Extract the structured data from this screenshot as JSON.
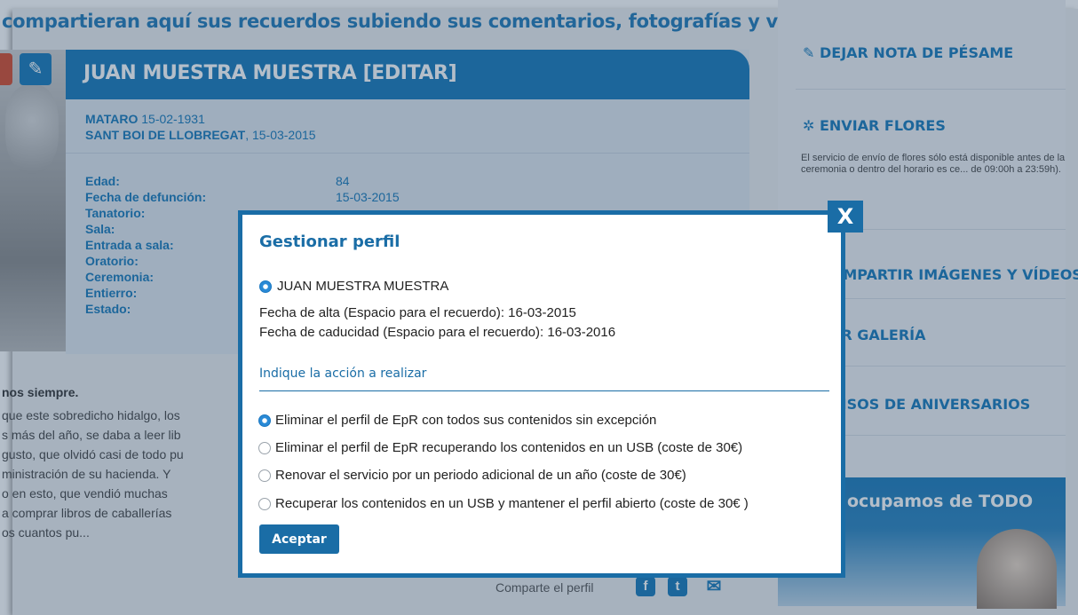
{
  "intro": "compartieran aquí sus recuerdos subiendo sus comentarios, fotografías y vídeos.",
  "profile": {
    "title": "JUAN MUESTRA MUESTRA [EDITAR]",
    "birth_place": "MATARO",
    "birth_date": " 15-02-1931",
    "death_place": "SANT BOI DE LLOBREGAT",
    "death_date": ", 15-03-2015",
    "fields": [
      {
        "label": "Edad:",
        "value": "84"
      },
      {
        "label": "Fecha de defunción:",
        "value": "15-03-2015"
      },
      {
        "label": "Tanatorio:",
        "value": ""
      },
      {
        "label": "Sala:",
        "value": ""
      },
      {
        "label": "Entrada a sala:",
        "value": ""
      },
      {
        "label": "Oratorio:",
        "value": ""
      },
      {
        "label": "Ceremonia:",
        "value": ""
      },
      {
        "label": "Entierro:",
        "value": ""
      },
      {
        "label": "Estado:",
        "value": ""
      }
    ]
  },
  "obituary": {
    "heading": "nos siempre.",
    "lines": [
      "que este sobredicho hidalgo, los",
      "s más del año, se daba a leer lib",
      "gusto, que olvidó casi de todo pu",
      "ministración de su hacienda. Y",
      "o en esto, que vendió muchas",
      "a comprar libros de caballerías",
      "os cuantos pu..."
    ]
  },
  "share": {
    "label": "Comparte el perfil"
  },
  "sidebar": {
    "items": [
      {
        "label": "DEJAR NOTA DE PÉSAME"
      },
      {
        "label": "ENVIAR FLORES"
      },
      {
        "label": "COMPARTIR IMÁGENES Y VÍDEOS"
      },
      {
        "label": "VER GALERÍA"
      },
      {
        "label": "AVISOS DE ANIVERSARIOS"
      }
    ],
    "flowers_note": "El servicio de envío de flores sólo está disponible antes de la ceremonia o dentro del horario es ce... de 09:00h a 23:59h).",
    "banner": "ocupamos de TODO"
  },
  "modal": {
    "close_label": "X",
    "title": "Gestionar perfil",
    "profile_name": "JUAN MUESTRA MUESTRA",
    "alta": "Fecha de alta (Espacio para el recuerdo): 16-03-2015",
    "caducidad": "Fecha de caducidad (Espacio para el recuerdo): 16-03-2016",
    "subheading": "Indique la acción a realizar",
    "options": [
      {
        "label": "Eliminar el perfil de EpR con todos sus contenidos sin excepción",
        "selected": true
      },
      {
        "label": "Eliminar el perfil de EpR recuperando los contenidos en un USB (coste de 30€)",
        "selected": false
      },
      {
        "label": "Renovar el servicio por un periodo adicional de un año (coste de 30€)",
        "selected": false
      },
      {
        "label": "Recuperar los contenidos en un USB y mantener el perfil abierto (coste de 30€ )",
        "selected": false
      }
    ],
    "accept_label": "Aceptar"
  },
  "colors": {
    "accent": "#1a6da6",
    "header": "#1679b8"
  }
}
